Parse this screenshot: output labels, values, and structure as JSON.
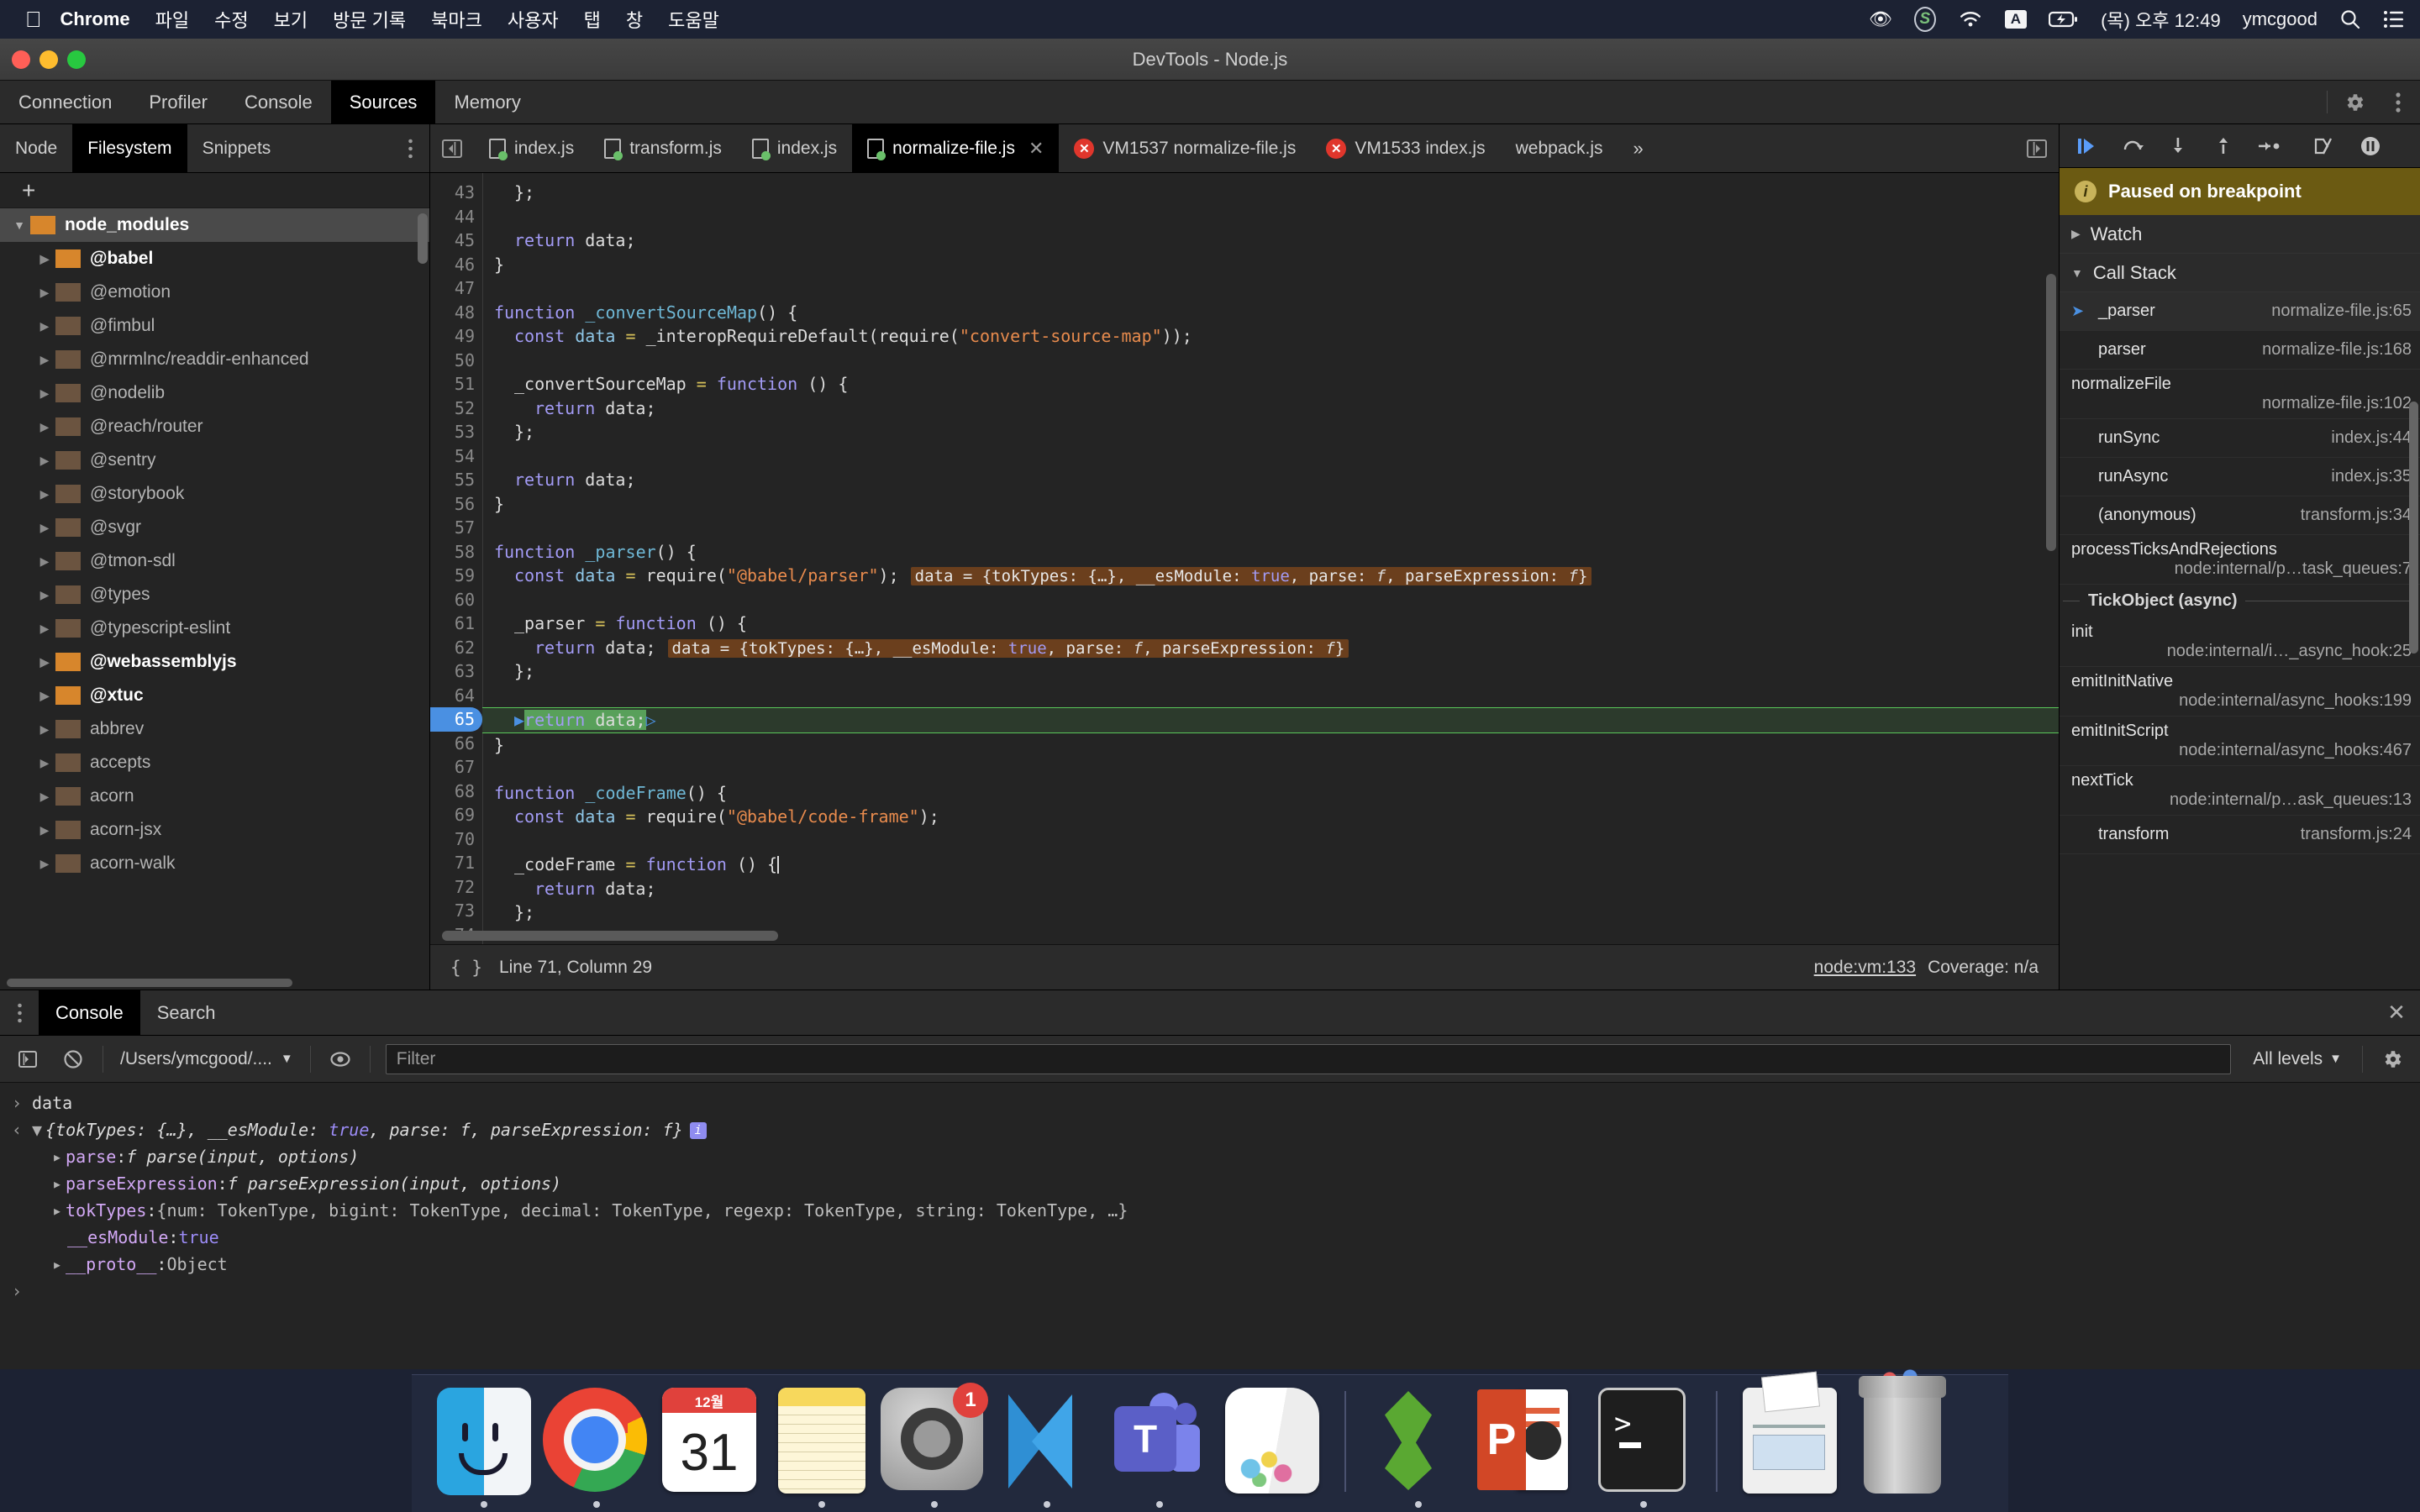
{
  "menubar": {
    "apple_icon": "apple-icon",
    "app_name": "Chrome",
    "items": [
      "파일",
      "수정",
      "보기",
      "방문 기록",
      "북마크",
      "사용자",
      "탭",
      "창",
      "도움말"
    ],
    "status": {
      "eye_icon": "eye-icon",
      "snip_icon": "snip-app-icon",
      "wifi_icon": "wifi-icon",
      "input_source": "A",
      "battery_icon": "battery-charging-icon",
      "datetime": "(목) 오후 12:49",
      "user": "ymcgood",
      "search_icon": "spotlight-search-icon",
      "control_center_icon": "control-center-icon"
    }
  },
  "window": {
    "title": "DevTools - Node.js"
  },
  "devtools": {
    "main_tabs": [
      {
        "label": "Connection",
        "active": false
      },
      {
        "label": "Profiler",
        "active": false
      },
      {
        "label": "Console",
        "active": false
      },
      {
        "label": "Sources",
        "active": true
      },
      {
        "label": "Memory",
        "active": false
      }
    ],
    "settings_icon": "gear-icon",
    "more_icon": "kebab-menu-icon"
  },
  "navigator": {
    "tabs": [
      {
        "label": "Node",
        "active": false
      },
      {
        "label": "Filesystem",
        "active": true
      },
      {
        "label": "Snippets",
        "active": false
      }
    ],
    "more_icon": "kebab-menu-icon",
    "add_label": "+",
    "tree": [
      {
        "label": "node_modules",
        "depth": 0,
        "expanded": true,
        "selected": true,
        "highlight": true
      },
      {
        "label": "@babel",
        "depth": 1,
        "expanded": false,
        "selected": false,
        "highlight": true
      },
      {
        "label": "@emotion",
        "depth": 1,
        "expanded": false,
        "selected": false,
        "highlight": false
      },
      {
        "label": "@fimbul",
        "depth": 1,
        "expanded": false,
        "selected": false,
        "highlight": false
      },
      {
        "label": "@mrmlnc/readdir-enhanced",
        "depth": 1,
        "expanded": false,
        "selected": false,
        "highlight": false
      },
      {
        "label": "@nodelib",
        "depth": 1,
        "expanded": false,
        "selected": false,
        "highlight": false
      },
      {
        "label": "@reach/router",
        "depth": 1,
        "expanded": false,
        "selected": false,
        "highlight": false
      },
      {
        "label": "@sentry",
        "depth": 1,
        "expanded": false,
        "selected": false,
        "highlight": false
      },
      {
        "label": "@storybook",
        "depth": 1,
        "expanded": false,
        "selected": false,
        "highlight": false
      },
      {
        "label": "@svgr",
        "depth": 1,
        "expanded": false,
        "selected": false,
        "highlight": false
      },
      {
        "label": "@tmon-sdl",
        "depth": 1,
        "expanded": false,
        "selected": false,
        "highlight": false
      },
      {
        "label": "@types",
        "depth": 1,
        "expanded": false,
        "selected": false,
        "highlight": false
      },
      {
        "label": "@typescript-eslint",
        "depth": 1,
        "expanded": false,
        "selected": false,
        "highlight": false
      },
      {
        "label": "@webassemblyjs",
        "depth": 1,
        "expanded": false,
        "selected": false,
        "highlight": true
      },
      {
        "label": "@xtuc",
        "depth": 1,
        "expanded": false,
        "selected": false,
        "highlight": true
      },
      {
        "label": "abbrev",
        "depth": 1,
        "expanded": false,
        "selected": false,
        "highlight": false
      },
      {
        "label": "accepts",
        "depth": 1,
        "expanded": false,
        "selected": false,
        "highlight": false
      },
      {
        "label": "acorn",
        "depth": 1,
        "expanded": false,
        "selected": false,
        "highlight": false
      },
      {
        "label": "acorn-jsx",
        "depth": 1,
        "expanded": false,
        "selected": false,
        "highlight": false
      },
      {
        "label": "acorn-walk",
        "depth": 1,
        "expanded": false,
        "selected": false,
        "highlight": false
      }
    ]
  },
  "file_tabs": {
    "collapse_icon": "collapse-sidebar-icon",
    "tabs": [
      {
        "label": "index.js",
        "type": "js",
        "active": false,
        "closable": false
      },
      {
        "label": "transform.js",
        "type": "js",
        "active": false,
        "closable": false
      },
      {
        "label": "index.js",
        "type": "js",
        "active": false,
        "closable": false
      },
      {
        "label": "normalize-file.js",
        "type": "js",
        "active": true,
        "closable": true
      },
      {
        "label": "VM1537 normalize-file.js",
        "type": "error",
        "active": false,
        "closable": false
      },
      {
        "label": "VM1533 index.js",
        "type": "error",
        "active": false,
        "closable": false
      },
      {
        "label": "webpack.js",
        "type": "plain",
        "active": false,
        "closable": false
      }
    ],
    "overflow_label": "»",
    "expand_panel_icon": "expand-panel-icon"
  },
  "editor": {
    "first_line": 43,
    "lines": [
      {
        "n": 43,
        "indent": 1,
        "html": "<span class=\"pl\">};</span>"
      },
      {
        "n": 44,
        "indent": 0,
        "html": ""
      },
      {
        "n": 45,
        "indent": 1,
        "html": "<span class=\"kw\">return</span> <span class=\"pl\">data;</span>"
      },
      {
        "n": 46,
        "indent": 0,
        "html": "<span class=\"pl\">}</span>"
      },
      {
        "n": 47,
        "indent": 0,
        "html": ""
      },
      {
        "n": 48,
        "indent": 0,
        "html": "<span class=\"kw\">function</span> <span class=\"fn\">_convertSourceMap</span><span class=\"pl\">() {</span>"
      },
      {
        "n": 49,
        "indent": 1,
        "html": "<span class=\"kw\">const</span> <span class=\"var\">data</span> <span class=\"op\">=</span> <span class=\"pl\">_interopRequireDefault(require(</span><span class=\"str\">\"convert-source-map\"</span><span class=\"pl\">));</span>"
      },
      {
        "n": 50,
        "indent": 0,
        "html": ""
      },
      {
        "n": 51,
        "indent": 1,
        "html": "<span class=\"pl\">_convertSourceMap</span> <span class=\"op\">=</span> <span class=\"kw\">function</span> <span class=\"pl\">() {</span>"
      },
      {
        "n": 52,
        "indent": 2,
        "html": "<span class=\"kw\">return</span> <span class=\"pl\">data;</span>"
      },
      {
        "n": 53,
        "indent": 1,
        "html": "<span class=\"pl\">};</span>"
      },
      {
        "n": 54,
        "indent": 0,
        "html": ""
      },
      {
        "n": 55,
        "indent": 1,
        "html": "<span class=\"kw\">return</span> <span class=\"pl\">data;</span>"
      },
      {
        "n": 56,
        "indent": 0,
        "html": "<span class=\"pl\">}</span>"
      },
      {
        "n": 57,
        "indent": 0,
        "html": ""
      },
      {
        "n": 58,
        "indent": 0,
        "html": "<span class=\"kw\">function</span> <span class=\"fn\">_parser</span><span class=\"pl\">() {</span>"
      },
      {
        "n": 59,
        "indent": 1,
        "html": "<span class=\"kw\">const</span> <span class=\"var\">data</span> <span class=\"op\">=</span> <span class=\"pl\">require(</span><span class=\"str\">\"@babel/parser\"</span><span class=\"pl\">);</span><span class=\"hint\">data = {tokTypes: {…}, __esModule: <span class=\"tt\">true</span>, parse: <i>f</i>, parseExpression: <i>f</i>}</span>"
      },
      {
        "n": 60,
        "indent": 0,
        "html": ""
      },
      {
        "n": 61,
        "indent": 1,
        "html": "<span class=\"pl\">_parser</span> <span class=\"op\">=</span> <span class=\"kw\">function</span> <span class=\"pl\">() {</span>"
      },
      {
        "n": 62,
        "indent": 2,
        "html": "<span class=\"kw\">return</span> <span class=\"pl\">data;</span><span class=\"hint\">data = {tokTypes: {…}, __esModule: <span class=\"tt\">true</span>, parse: <i>f</i>, parseExpression: <i>f</i>}</span>"
      },
      {
        "n": 63,
        "indent": 1,
        "html": "<span class=\"pl\">};</span>"
      },
      {
        "n": 64,
        "indent": 0,
        "html": ""
      },
      {
        "n": 65,
        "indent": 1,
        "exec": true,
        "html": "<span class=\"bluearrow\">▶</span><span class=\"execmark\"><span class=\"kw\">return</span> <span class=\"pl\">data;</span></span><span class=\"bluearrow\">▷</span>"
      },
      {
        "n": 66,
        "indent": 0,
        "html": "<span class=\"pl\">}</span>"
      },
      {
        "n": 67,
        "indent": 0,
        "html": ""
      },
      {
        "n": 68,
        "indent": 0,
        "html": "<span class=\"kw\">function</span> <span class=\"fn\">_codeFrame</span><span class=\"pl\">() {</span>"
      },
      {
        "n": 69,
        "indent": 1,
        "html": "<span class=\"kw\">const</span> <span class=\"var\">data</span> <span class=\"op\">=</span> <span class=\"pl\">require(</span><span class=\"str\">\"@babel/code-frame\"</span><span class=\"pl\">);</span>"
      },
      {
        "n": 70,
        "indent": 0,
        "html": ""
      },
      {
        "n": 71,
        "indent": 1,
        "html": "<span class=\"pl\">_codeFrame</span> <span class=\"op\">=</span> <span class=\"kw\">function</span> <span class=\"pl\">() {</span><span class=\"caret\"></span>"
      },
      {
        "n": 72,
        "indent": 2,
        "html": "<span class=\"kw\">return</span> <span class=\"pl\">data;</span>"
      },
      {
        "n": 73,
        "indent": 1,
        "html": "<span class=\"pl\">};</span>"
      },
      {
        "n": 74,
        "indent": 0,
        "html": ""
      }
    ],
    "breakpoint_line": 65,
    "execution_line": 65
  },
  "status_bar": {
    "format_icon": "pretty-print-icon",
    "position": "Line 71, Column 29",
    "source_link": "node:vm:133",
    "coverage": "Coverage: n/a"
  },
  "debugger": {
    "toolbar": [
      {
        "icon": "resume-script-icon",
        "name": "resume-button"
      },
      {
        "icon": "step-over-icon",
        "name": "step-over-button"
      },
      {
        "icon": "step-into-icon",
        "name": "step-into-button"
      },
      {
        "icon": "step-out-icon",
        "name": "step-out-button"
      },
      {
        "icon": "step-icon",
        "name": "step-button"
      },
      {
        "icon": "deactivate-breakpoints-icon",
        "name": "deactivate-breakpoints-button"
      },
      {
        "icon": "pause-on-exceptions-icon",
        "name": "pause-on-exceptions-button"
      }
    ],
    "paused_message": "Paused on breakpoint",
    "watch_label": "Watch",
    "call_stack_label": "Call Stack",
    "call_stack": [
      {
        "name": "_parser",
        "location": "normalize-file.js:65",
        "current": true,
        "stacked": false
      },
      {
        "name": "parser",
        "location": "normalize-file.js:168",
        "current": false,
        "stacked": false
      },
      {
        "name": "normalizeFile",
        "location": "normalize-file.js:102",
        "current": false,
        "stacked": true
      },
      {
        "name": "runSync",
        "location": "index.js:44",
        "current": false,
        "stacked": false
      },
      {
        "name": "runAsync",
        "location": "index.js:35",
        "current": false,
        "stacked": false
      },
      {
        "name": "(anonymous)",
        "location": "transform.js:34",
        "current": false,
        "stacked": false
      },
      {
        "name": "processTicksAndRejections",
        "location": "node:internal/p…task_queues:7",
        "current": false,
        "stacked": true
      }
    ],
    "async_separator": "TickObject (async)",
    "call_stack_async": [
      {
        "name": "init",
        "location": "node:internal/i…_async_hook:25",
        "current": false,
        "stacked": true
      },
      {
        "name": "emitInitNative",
        "location": "node:internal/async_hooks:199",
        "current": false,
        "stacked": true
      },
      {
        "name": "emitInitScript",
        "location": "node:internal/async_hooks:467",
        "current": false,
        "stacked": true
      },
      {
        "name": "nextTick",
        "location": "node:internal/p…ask_queues:13",
        "current": false,
        "stacked": true
      },
      {
        "name": "transform",
        "location": "transform.js:24",
        "current": false,
        "stacked": false
      }
    ]
  },
  "drawer": {
    "more_icon": "kebab-menu-icon",
    "tabs": [
      {
        "label": "Console",
        "active": true
      },
      {
        "label": "Search",
        "active": false
      }
    ],
    "close_icon": "close-icon",
    "toolbar": {
      "sidebar_icon": "console-sidebar-icon",
      "clear_icon": "clear-console-icon",
      "context": "/Users/ymcgood/....",
      "context_caret": "▼",
      "eye_icon": "live-expression-icon",
      "filter_placeholder": "Filter",
      "filter_value": "",
      "levels": "All levels",
      "levels_caret": "▼",
      "settings_icon": "gear-icon"
    },
    "output": {
      "input_prompt": "›",
      "input_text": "data",
      "result_prompt": "‹",
      "result_summary_html": "<span class=\"citri\">▼</span><span class=\"obj\">{tokTypes: {…}, __esModule: <span class=\"ctrue\">true</span>, parse: <i>f</i>, parseExpression: <i>f</i>}</span><span class=\"infoi\">i</span>",
      "properties": [
        {
          "html": "<span class=\"citri\">▸</span><span class=\"kname\">parse</span>: <span class=\"fnm\">f parse(input, options)</span>"
        },
        {
          "html": "<span class=\"citri\">▸</span><span class=\"kname\">parseExpression</span>: <span class=\"fnm\">f parseExpression(input, options)</span>"
        },
        {
          "html": "<span class=\"citri\">▸</span><span class=\"kname\">tokTypes</span>: <span class=\"gray\">{num: TokenType, bigint: TokenType, decimal: TokenType, regexp: TokenType, string: TokenType, …}</span>"
        },
        {
          "html": "<span style=\"padding-left:18px\"></span><span class=\"kname\">__esModule</span>: <span class=\"ctrue\">true</span>"
        },
        {
          "html": "<span class=\"citri\">▸</span><span class=\"kname\">__proto__</span>: <span class=\"gray\">Object</span>"
        }
      ],
      "final_prompt": "›"
    }
  },
  "dock": {
    "items": [
      {
        "name": "finder",
        "label": "Finder",
        "running": true
      },
      {
        "name": "chrome",
        "label": "Google Chrome",
        "running": true
      },
      {
        "name": "calendar",
        "label": "Calendar",
        "month": "12월",
        "day": "31",
        "running": false
      },
      {
        "name": "notes",
        "label": "Notes",
        "running": false
      },
      {
        "name": "system-preferences",
        "label": "System Preferences",
        "badge": "1",
        "running": true
      },
      {
        "name": "vscode",
        "label": "Visual Studio Code",
        "running": true
      },
      {
        "name": "teams",
        "label": "Microsoft Teams",
        "letter": "T",
        "running": true
      },
      {
        "name": "jug",
        "label": "Jug",
        "running": false
      },
      {
        "name": "evernote",
        "label": "Evernote",
        "running": true
      },
      {
        "name": "powerpoint",
        "label": "PowerPoint",
        "letter": "P",
        "running": false
      },
      {
        "name": "terminal",
        "label": "Terminal",
        "running": true
      },
      {
        "name": "scanner",
        "label": "Scanner",
        "running": false
      },
      {
        "name": "trash",
        "label": "Trash",
        "running": false
      }
    ]
  },
  "colors": {
    "accent_blue": "#4a90e2",
    "exec_green": "#5ac85a",
    "paused_yellow": "#6b5a12",
    "hint_brown": "#6b3f1d",
    "error_red": "#e0362c",
    "folder_orange": "#d7862c"
  }
}
